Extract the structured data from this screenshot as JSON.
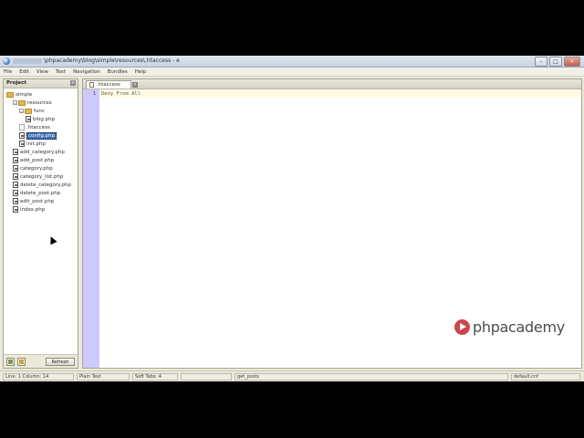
{
  "window": {
    "title": "\\phpacademy\\blog\\simple\\resources\\.htaccess - e",
    "buttons": {
      "minimize": "–",
      "maximize": "□",
      "close": "×"
    }
  },
  "menu": [
    "File",
    "Edit",
    "View",
    "Text",
    "Navigation",
    "Bundles",
    "Help"
  ],
  "project_panel": {
    "title": "Project",
    "close": "×",
    "tree": [
      {
        "label": "simple",
        "type": "folder",
        "depth": 0
      },
      {
        "label": "resources",
        "type": "folder",
        "depth": 1,
        "toggle": "−"
      },
      {
        "label": "func",
        "type": "folder",
        "depth": 2,
        "toggle": "−"
      },
      {
        "label": "blog.php",
        "type": "php",
        "depth": 3
      },
      {
        "label": ".htaccess",
        "type": "plain",
        "depth": 2
      },
      {
        "label": "config.php",
        "type": "php",
        "depth": 2,
        "selected": true
      },
      {
        "label": "init.php",
        "type": "php",
        "depth": 2
      },
      {
        "label": "add_category.php",
        "type": "php",
        "depth": 1
      },
      {
        "label": "add_post.php",
        "type": "php",
        "depth": 1
      },
      {
        "label": "category.php",
        "type": "php",
        "depth": 1
      },
      {
        "label": "category_list.php",
        "type": "php",
        "depth": 1
      },
      {
        "label": "delete_category.php",
        "type": "php",
        "depth": 1
      },
      {
        "label": "delete_post.php",
        "type": "php",
        "depth": 1
      },
      {
        "label": "edit_post.php",
        "type": "php",
        "depth": 1
      },
      {
        "label": "index.php",
        "type": "php",
        "depth": 1
      }
    ],
    "refresh_label": "Refresh"
  },
  "editor": {
    "tab_label": ".htaccess",
    "tab_close": "×",
    "lines": [
      {
        "number": "1",
        "text": "Deny From All"
      }
    ]
  },
  "statusbar": {
    "position": "Line: 1  Column: 14",
    "language": "Plain Text",
    "tabs": "Soft Tabs: 4",
    "symbol": "get_posts",
    "theme": "default.cnf"
  },
  "watermark": "phpacademy",
  "icons": [
    "app-icon",
    "folder-icon",
    "php-file-icon",
    "plain-file-icon",
    "close-icon",
    "add-folder-icon",
    "add-file-icon",
    "mouse-cursor-icon",
    "play-logo-icon"
  ]
}
